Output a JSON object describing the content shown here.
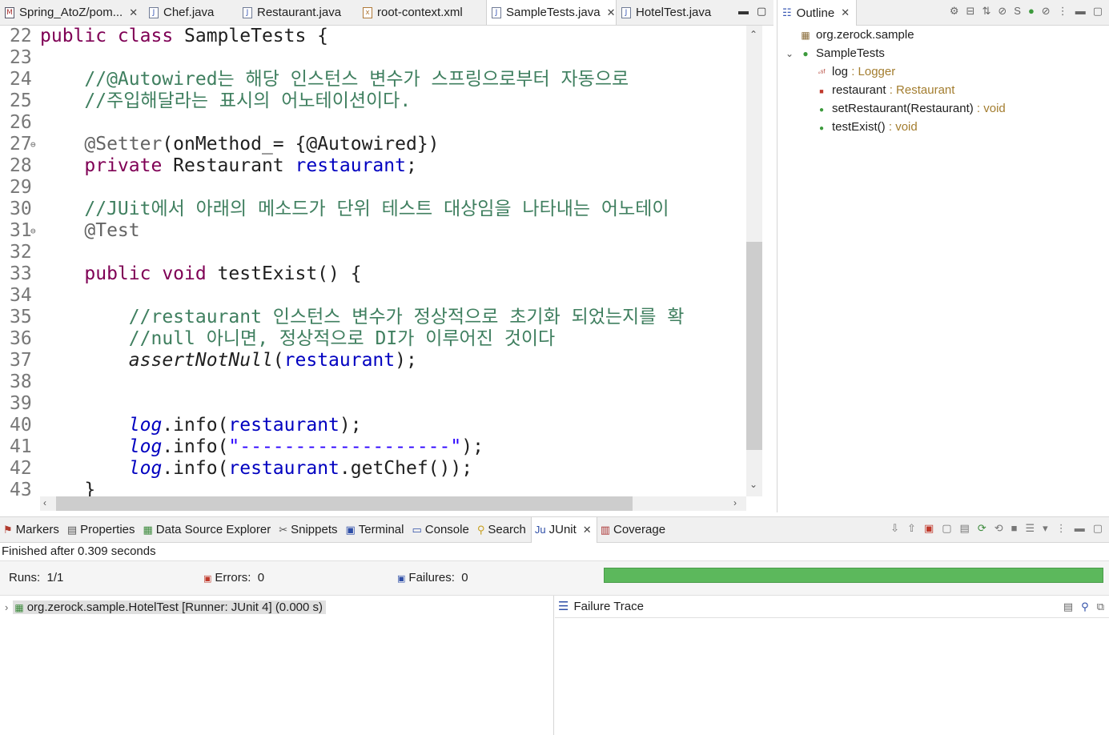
{
  "editor_tabs": [
    {
      "label": "Spring_AtoZ/pom...",
      "icon": "maven-pom-icon",
      "closable": true
    },
    {
      "label": "Chef.java",
      "icon": "java-file-icon",
      "closable": false
    },
    {
      "label": "Restaurant.java",
      "icon": "java-file-icon",
      "closable": false
    },
    {
      "label": "root-context.xml",
      "icon": "xml-file-icon",
      "closable": false
    },
    {
      "label": "SampleTests.java",
      "icon": "java-file-icon",
      "closable": true,
      "active": true
    },
    {
      "label": "HotelTest.java",
      "icon": "java-file-icon",
      "closable": false
    }
  ],
  "editor": {
    "line_numbers": [
      "22",
      "23",
      "24",
      "25",
      "26",
      "27",
      "28",
      "29",
      "30",
      "31",
      "32",
      "33",
      "34",
      "35",
      "36",
      "37",
      "38",
      "39",
      "40",
      "41",
      "42",
      "43"
    ],
    "lines": {
      "l22_kw": "public class ",
      "l22_rest": "SampleTests {",
      "l24": "    //@Autowired는 해당 인스턴스 변수가 스프링으로부터 자동으로",
      "l25": "    //주입해달라는 표시의 어노테이션이다.",
      "l27_ann": "    @Setter",
      "l27_rest": "(onMethod_= {@Autowired})",
      "l28_kw": "    private ",
      "l28_type": "Restaurant ",
      "l28_field": "restaurant",
      "l28_end": ";",
      "l30": "    //JUit에서 아래의 메소드가 단위 테스트 대상임을 나타내는 어노테이",
      "l31": "    @Test",
      "l33_kw": "    public void ",
      "l33_rest": "testExist() {",
      "l35": "        //restaurant 인스턴스 변수가 정상적으로 초기화 되었는지를 확",
      "l36": "        //null 아니면, 정상적으로 DI가 이루어진 것이다",
      "l37_method": "        assertNotNull",
      "l37_open": "(",
      "l37_field": "restaurant",
      "l37_end": ");",
      "l40_log": "        log",
      "l40_info": ".info(",
      "l40_field": "restaurant",
      "l40_end": ");",
      "l41_log": "        log",
      "l41_info": ".info(",
      "l41_str": "\"-------------------\"",
      "l41_end": ");",
      "l42_log": "        log",
      "l42_info": ".info(",
      "l42_field": "restaurant",
      "l42_call": ".getChef());",
      "l43": "    }"
    }
  },
  "outline": {
    "tab_label": "Outline",
    "package": "org.zerock.sample",
    "class_name": "SampleTests",
    "members": [
      {
        "name": "log",
        "type": " : Logger",
        "icon": "static-final-field-icon"
      },
      {
        "name": "restaurant",
        "type": " : Restaurant",
        "icon": "private-field-icon"
      },
      {
        "name": "setRestaurant(Restaurant)",
        "type": " : void",
        "icon": "public-method-icon"
      },
      {
        "name": "testExist()",
        "type": " : void",
        "icon": "public-method-icon"
      }
    ]
  },
  "bottom_tabs": [
    {
      "label": "Markers",
      "icon": "markers-icon"
    },
    {
      "label": "Properties",
      "icon": "properties-icon"
    },
    {
      "label": "Data Source Explorer",
      "icon": "data-source-icon"
    },
    {
      "label": "Snippets",
      "icon": "snippets-icon"
    },
    {
      "label": "Terminal",
      "icon": "terminal-icon"
    },
    {
      "label": "Console",
      "icon": "console-icon"
    },
    {
      "label": "Search",
      "icon": "search-icon"
    },
    {
      "label": "JUnit",
      "icon": "junit-icon",
      "active": true,
      "closable": true
    },
    {
      "label": "Coverage",
      "icon": "coverage-icon"
    }
  ],
  "junit": {
    "status": "Finished after 0.309 seconds",
    "runs_label": "Runs:",
    "runs_value": "1/1",
    "errors_label": "Errors:",
    "errors_value": "0",
    "failures_label": "Failures:",
    "failures_value": "0",
    "progress_fraction": 1.0,
    "progress_color": "#5cb85c",
    "tree_item": "org.zerock.sample.HotelTest [Runner: JUnit 4] (0.000 s)",
    "failure_trace_label": "Failure Trace"
  },
  "colors": {
    "keyword": "#7f0055",
    "comment": "#3f7f5f",
    "field": "#0000c0",
    "string": "#2a00ff",
    "annotation": "#646464"
  }
}
